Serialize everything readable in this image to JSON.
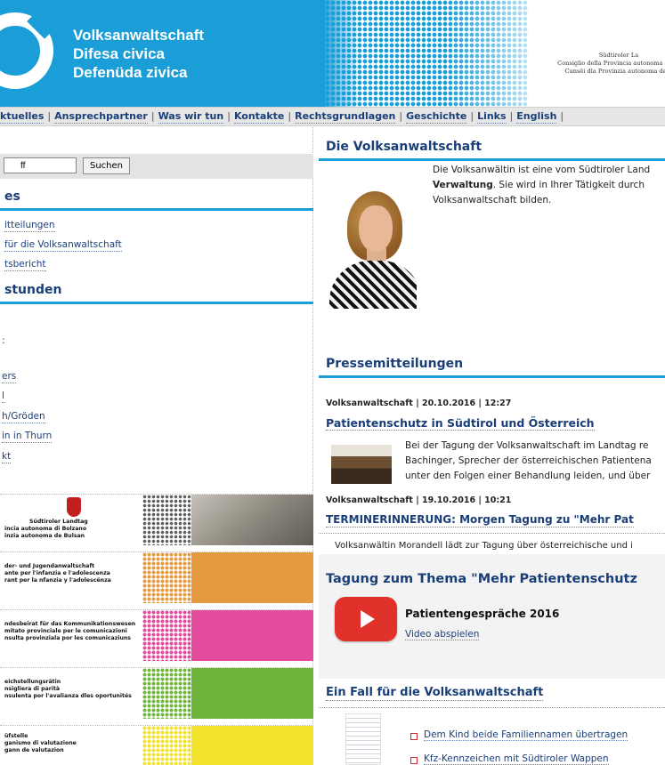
{
  "header": {
    "title_lines": [
      "Volksanwaltschaft",
      "Difesa civica",
      "Defenüda zivica"
    ],
    "landtag_lines": [
      "Südtiroler La",
      "Consiglio della Provincia autonoma di Bo",
      "Cunsëi dla Provinzia autonoma de B"
    ]
  },
  "nav": {
    "items": [
      "ktuelles",
      "Ansprechpartner",
      "Was wir tun",
      "Kontakte",
      "Rechtsgrundlagen",
      "Geschichte",
      "Links",
      "English"
    ],
    "separator": "|"
  },
  "sidebar": {
    "search_value": "ff",
    "search_button": "Suchen",
    "section1_title": "es",
    "section1_links": [
      "itteilungen",
      "für die Volksanwaltschaft",
      "tsbericht"
    ],
    "section2_title": "stunden",
    "section2_items": [
      ":",
      "ers",
      "l",
      "h/Gröden",
      "in in Thurn",
      "kt"
    ],
    "banners": [
      {
        "lines": [
          "Südtiroler Landtag",
          "incia autonoma di Bolzano",
          "inzia autonoma de Bulsan"
        ],
        "color": "#8f8a80"
      },
      {
        "lines": [
          "der- und Jugendanwaltschaft",
          "ante per l'infanzia e l'adolescenza",
          "rant per la nfanzia y l'adolescënza"
        ],
        "color": "#e49a3f"
      },
      {
        "lines": [
          "ndesbeirat für das Kommunikationswesen",
          "mitato provinciale per le comunicazioni",
          "nsulta provinziala por les comunicaziuns"
        ],
        "color": "#e34c9c"
      },
      {
        "lines": [
          "eichstellungsrätin",
          "nsigliera di parità",
          "nsulenta por l'avalianza dles oportunités"
        ],
        "color": "#6fb43b"
      },
      {
        "lines": [
          "üfstelle",
          "ganismo di valutazione",
          "gann de valutazion"
        ],
        "color": "#f3e22b"
      }
    ]
  },
  "main": {
    "heading": "Die Volksanwaltschaft",
    "intro_lines": [
      "Die Volksanwältin ist eine vom Südtiroler Land",
      "Verwaltung",
      ". Sie wird in Ihrer Tätigkeit durch",
      "Volksanwaltschaft bilden."
    ],
    "press_heading": "Pressemitteilungen",
    "news": [
      {
        "meta": "Volksanwaltschaft | 20.10.2016 | 12:27",
        "title": "Patientenschutz in Südtirol und Österreich",
        "teaser_lines": [
          "Bei der Tagung der Volksanwaltschaft im Landtag re",
          "Bachinger, Sprecher der österreichischen Patientena",
          "unter den Folgen einer Behandlung leiden, und über"
        ]
      },
      {
        "meta": "Volksanwaltschaft | 19.10.2016 | 10:21",
        "title": "TERMINERINNERUNG: Morgen Tagung zu \"Mehr Pat",
        "teaser": "Volksanwältin Morandell lädt zur Tagung über österreichische und i"
      }
    ],
    "video_heading": "Tagung zum Thema \"Mehr Patientenschutz",
    "video_title": "Patientengespräche 2016",
    "video_link": "Video abspielen",
    "case_heading": "Ein Fall für die Volksanwaltschaft",
    "case_links": [
      "Dem Kind beide Familiennamen übertragen",
      "Kfz-Kennzeichen mit Südtiroler Wappen"
    ]
  },
  "colors": {
    "brand_blue": "#1b9ed8",
    "link_navy": "#1a3f78",
    "youtube_red": "#e0312b"
  },
  "icons": [
    "logo-ring-icon",
    "eagle-coat-of-arms-icon",
    "youtube-play-icon",
    "bullet-square-icon",
    "document-thumbnail"
  ]
}
